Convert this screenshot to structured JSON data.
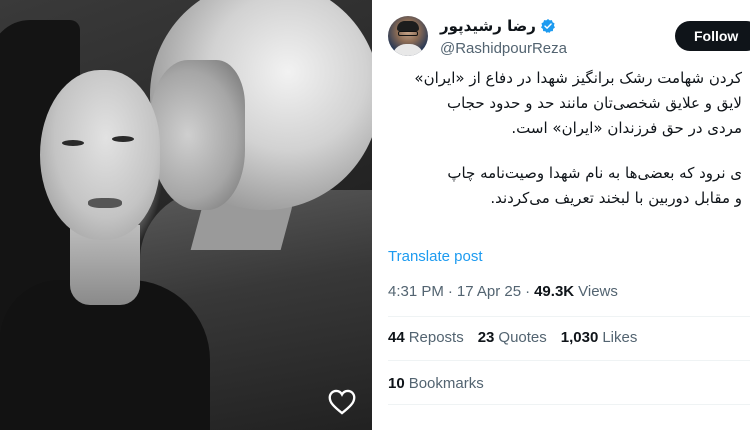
{
  "photo": {
    "like_icon": "heart-outline-icon"
  },
  "tweet": {
    "author": {
      "display_name": "رضا رشیدپور",
      "handle": "@RashidpourReza",
      "verified_icon": "verified-badge-icon",
      "verified_color": "#1d9bf0"
    },
    "follow_label": "Follow",
    "body_paragraphs": [
      [
        "کردن شهامت رشک برانگیز شهدا در دفاع از «ایران»",
        "لایق و علایق شخصی‌تان مانند حد و حدود حجاب",
        "مردی در حق فرزندان «ایران» است."
      ],
      [
        "ی نرود که بعضی‌ها به نام شهدا وصیت‌نامه چاپ",
        "و مقابل دوربین با لبخند تعریف می‌کردند."
      ]
    ],
    "translate_label": "Translate post",
    "time": "4:31 PM",
    "separator": "·",
    "date": "17 Apr 25",
    "views_count": "49.3K",
    "views_label": "Views",
    "stats": {
      "reposts_count": "44",
      "reposts_label": "Reposts",
      "quotes_count": "23",
      "quotes_label": "Quotes",
      "likes_count": "1,030",
      "likes_label": "Likes"
    },
    "bookmarks_count": "10",
    "bookmarks_label": "Bookmarks"
  },
  "colors": {
    "link": "#1d9bf0",
    "muted": "#536471",
    "text": "#0f1419",
    "follow_bg": "#0f1419"
  }
}
